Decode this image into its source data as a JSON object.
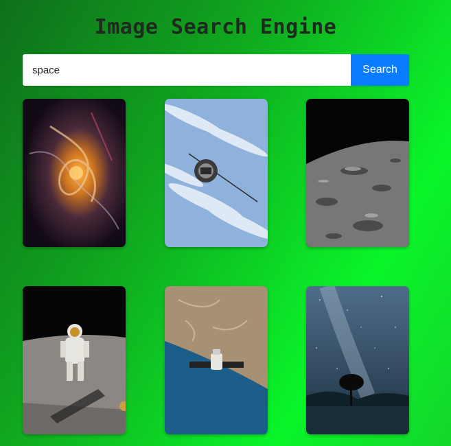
{
  "header": {
    "title": "Image Search Engine"
  },
  "search": {
    "value": "space",
    "placeholder": "",
    "button_label": "Search"
  },
  "results": [
    {
      "name": "result-image-nebula",
      "subject": "colorful nebula swirl"
    },
    {
      "name": "result-image-satellite",
      "subject": "satellite over clouds"
    },
    {
      "name": "result-image-moon-surface",
      "subject": "cratered moon surface"
    },
    {
      "name": "result-image-astronaut",
      "subject": "astronaut on the moon"
    },
    {
      "name": "result-image-spacecraft-earth",
      "subject": "spacecraft above earth coastline"
    },
    {
      "name": "result-image-milky-way",
      "subject": "milky way over lake and tree"
    }
  ],
  "colors": {
    "accent": "#0a7cff",
    "background_start": "#0f6f1c",
    "background_end": "#0af52a"
  }
}
